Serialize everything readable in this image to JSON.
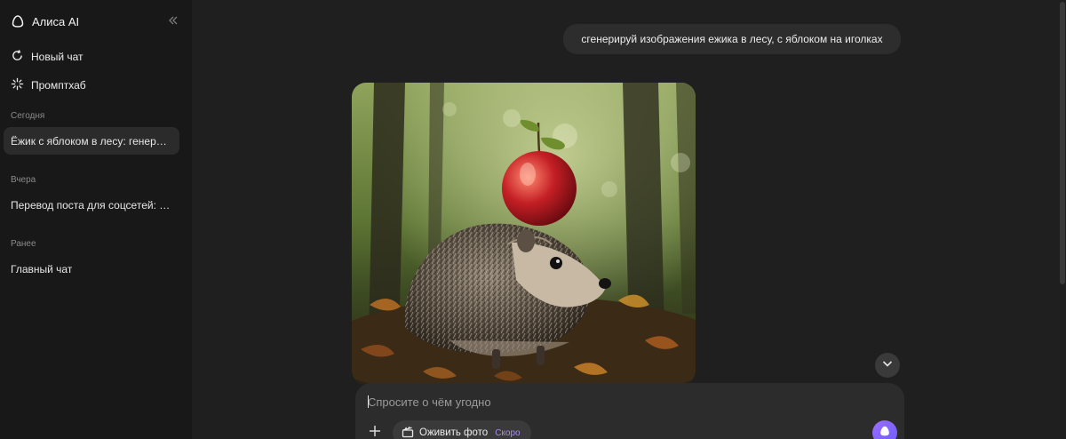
{
  "sidebar": {
    "brand": "Алиса AI",
    "new_chat": "Новый чат",
    "prompt_hub": "Промптхаб",
    "sections": [
      {
        "label": "Сегодня",
        "chats": [
          "Ёжик с яблоком в лесу: генерация изображения"
        ]
      },
      {
        "label": "Вчера",
        "chats": [
          "Перевод поста для соцсетей: оптимизация"
        ]
      },
      {
        "label": "Ранее",
        "chats": [
          "Главный чат"
        ]
      }
    ]
  },
  "chat": {
    "user_message": "сгенерируй изображения ежика в лесу, с яблоком на иголках",
    "image_icon": "generated-hedgehog-image"
  },
  "composer": {
    "placeholder": "Спросите о чём угодно",
    "value": "",
    "animate_label": "Оживить фото",
    "animate_badge": "Скоро"
  },
  "icons": {
    "brand": "alice-logo-icon",
    "collapse": "chevrons-left-icon",
    "new_chat": "refresh-chat-icon",
    "prompt_hub": "sparkle-icon",
    "scroll_down": "chevron-down-icon",
    "attach": "plus-icon",
    "animate": "clapperboard-icon",
    "send": "alice-send-icon"
  },
  "colors": {
    "accent": "#8b6cff",
    "background": "#1f1f1f",
    "sidebar": "#181818"
  }
}
